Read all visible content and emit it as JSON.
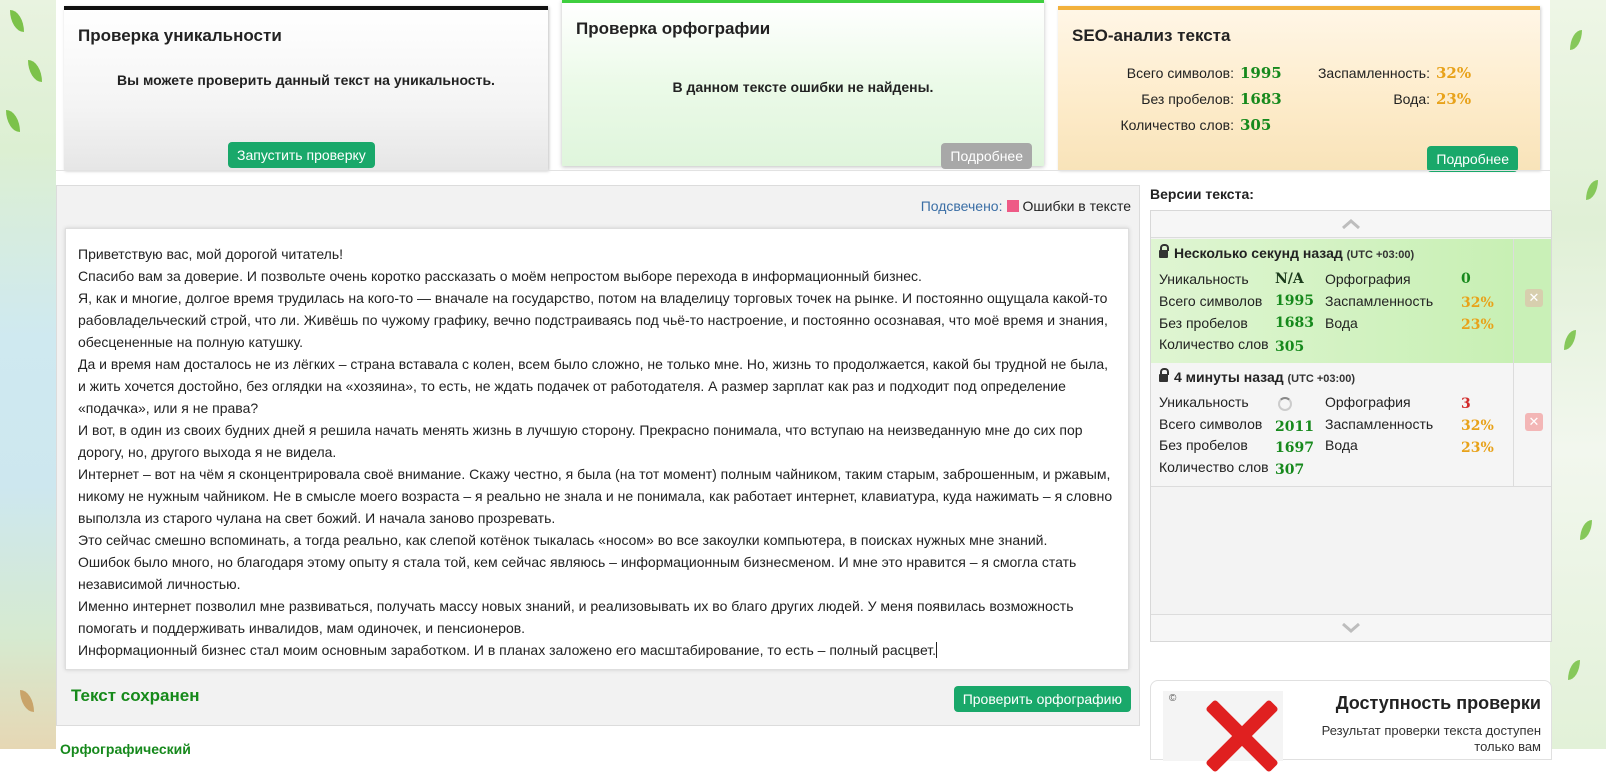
{
  "panels": {
    "uniqueness": {
      "title": "Проверка уникальности",
      "message": "Вы можете проверить данный текст на уникальность.",
      "button": "Запустить проверку"
    },
    "spelling": {
      "title": "Проверка орфографии",
      "message": "В данном тексте ошибки не найдены.",
      "button": "Подробнее"
    },
    "seo": {
      "title": "SEO-анализ текста",
      "total_chars_label": "Всего символов:",
      "total_chars": "1995",
      "no_spaces_label": "Без пробелов:",
      "no_spaces": "1683",
      "words_label": "Количество слов:",
      "words": "305",
      "spam_label": "Заспамленность:",
      "spam": "32%",
      "water_label": "Вода:",
      "water": "23%",
      "button": "Подробнее"
    }
  },
  "editor": {
    "highlight_label": "Подсвечено:",
    "highlight_text": "Ошибки в тексте",
    "paragraphs": [
      "Приветствую вас, мой дорогой читатель!",
      "Спасибо вам за доверие. И позвольте очень коротко рассказать о моём непростом выборе перехода в информационный бизнес.",
      "Я, как и многие, долгое время трудилась на кого-то — вначале на государство, потом на владелицу торговых точек на рынке. И постоянно ощущала какой-то рабовладельческий строй, что ли. Живёшь по чужому графику, вечно подстраиваясь под чьё-то настроение, и постоянно осознавая, что моё время и знания, обесцененные на полную катушку.",
      "Да и время нам досталось не из лёгких – страна вставала с колен, всем было сложно, не только мне. Но, жизнь то продолжается, какой бы трудной не была, и жить хочется достойно, без оглядки на «хозяина», то есть, не ждать подачек от работодателя. А размер зарплат как раз и подходит под определение «подачка», или я не права?",
      "И вот, в один из своих будних дней я решила начать менять жизнь в лучшую сторону. Прекрасно понимала, что вступаю на неизведанную мне до сих пор дорогу, но, другого выхода я не видела.",
      "Интернет – вот на чём я сконцентрировала своё внимание. Скажу честно, я была (на тот момент) полным чайником, таким старым, заброшенным, и ржавым, никому не нужным чайником. Не в смысле моего возраста – я реально не знала и не понимала, как работает интернет, клавиатура, куда нажимать – я словно выползла из старого чулана на свет божий. И начала заново прозревать.",
      "Это сейчас смешно вспоминать, а тогда реально, как слепой котёнок тыкалась «носом» во все закоулки компьютера, в поисках нужных мне знаний.",
      "Ошибок было много, но благодаря этому опыту я стала той, кем сейчас являюсь – информационным бизнесменом. И мне это нравится – я смогла стать независимой личностью.",
      "Именно интернет позволил мне развиваться, получать массу новых знаний, и реализовывать их во благо других людей. У меня появилась возможность помогать и поддерживать инвалидов, мам одиночек, и пенсионеров.",
      "Информационный бизнес стал моим основным заработком. И в планах заложено его масштабирование, то есть – полный расцвет."
    ],
    "saved_status": "Текст сохранен",
    "check_button": "Проверить орфографию",
    "cut_heading": "Орфографический"
  },
  "versions": {
    "title": "Версии текста:",
    "items": [
      {
        "time": "Несколько секунд назад",
        "tz": "(UTC +03:00)",
        "uniq_label": "Уникальность",
        "uniq": "N/A",
        "total_label": "Всего символов",
        "total": "1995",
        "nospace_label": "Без пробелов",
        "nospace": "1683",
        "words_label": "Количество слов",
        "words": "305",
        "spell_label": "Орфография",
        "spell": "0",
        "spam_label": "Заспамленность",
        "spam": "32%",
        "water_label": "Вода",
        "water": "23%"
      },
      {
        "time": "4 минуты назад",
        "tz": "(UTC +03:00)",
        "uniq_label": "Уникальность",
        "total_label": "Всего символов",
        "total": "2011",
        "nospace_label": "Без пробелов",
        "nospace": "1697",
        "words_label": "Количество слов",
        "words": "307",
        "spell_label": "Орфография",
        "spell": "3",
        "spam_label": "Заспамленность",
        "spam": "32%",
        "water_label": "Вода",
        "water": "23%"
      }
    ]
  },
  "availability": {
    "title": "Доступность проверки",
    "subtitle": "Результат проверки текста доступен только вам"
  },
  "icons": {
    "up": "chevron-up-icon",
    "down": "chevron-down-icon",
    "lock": "lock-icon",
    "delete": "close-icon"
  }
}
